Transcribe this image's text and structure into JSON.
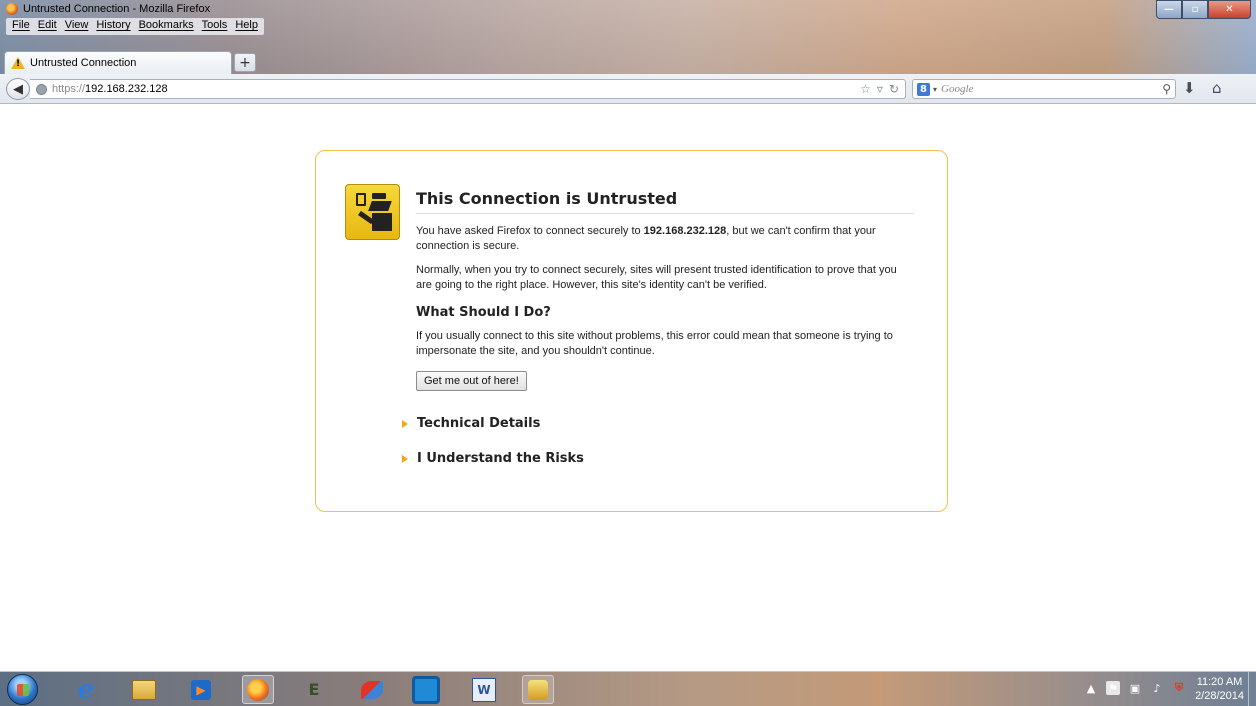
{
  "window": {
    "title": "Untrusted Connection - Mozilla Firefox",
    "menu": [
      "File",
      "Edit",
      "View",
      "History",
      "Bookmarks",
      "Tools",
      "Help"
    ]
  },
  "tabs": [
    {
      "label": "Untrusted Connection",
      "icon": "warning-icon",
      "active": true
    }
  ],
  "new_tab_label": "+",
  "nav": {
    "url_protocol": "https://",
    "url_host": "192.168.232.128",
    "search_engine": "Google",
    "search_placeholder": "Google"
  },
  "error": {
    "title": "This Connection is Untrusted",
    "p1_before": "You have asked Firefox to connect securely to ",
    "p1_host": "192.168.232.128",
    "p1_after": ", but we can't confirm that your connection is secure.",
    "p2": "Normally, when you try to connect securely, sites will present trusted identification to prove that you are going to the right place. However, this site's identity can't be verified.",
    "h2": "What Should I Do?",
    "p3": "If you usually connect to this site without problems, this error could mean that someone is trying to impersonate the site, and you shouldn't continue.",
    "escape_button": "Get me out of here!",
    "technical_details": "Technical Details",
    "understand_risks": "I Understand the Risks"
  },
  "taskbar": {
    "apps": [
      "start-orb",
      "internet-explorer",
      "file-explorer",
      "media-player",
      "firefox",
      "tool",
      "paint",
      "outlook",
      "word",
      "app"
    ],
    "clock_time": "11:20 AM",
    "clock_date": "2/28/2014"
  },
  "colors": {
    "error_border": "#f2c14e",
    "expander_arrow": "#f2a70f",
    "icon_yellow": "#f6d83a"
  }
}
